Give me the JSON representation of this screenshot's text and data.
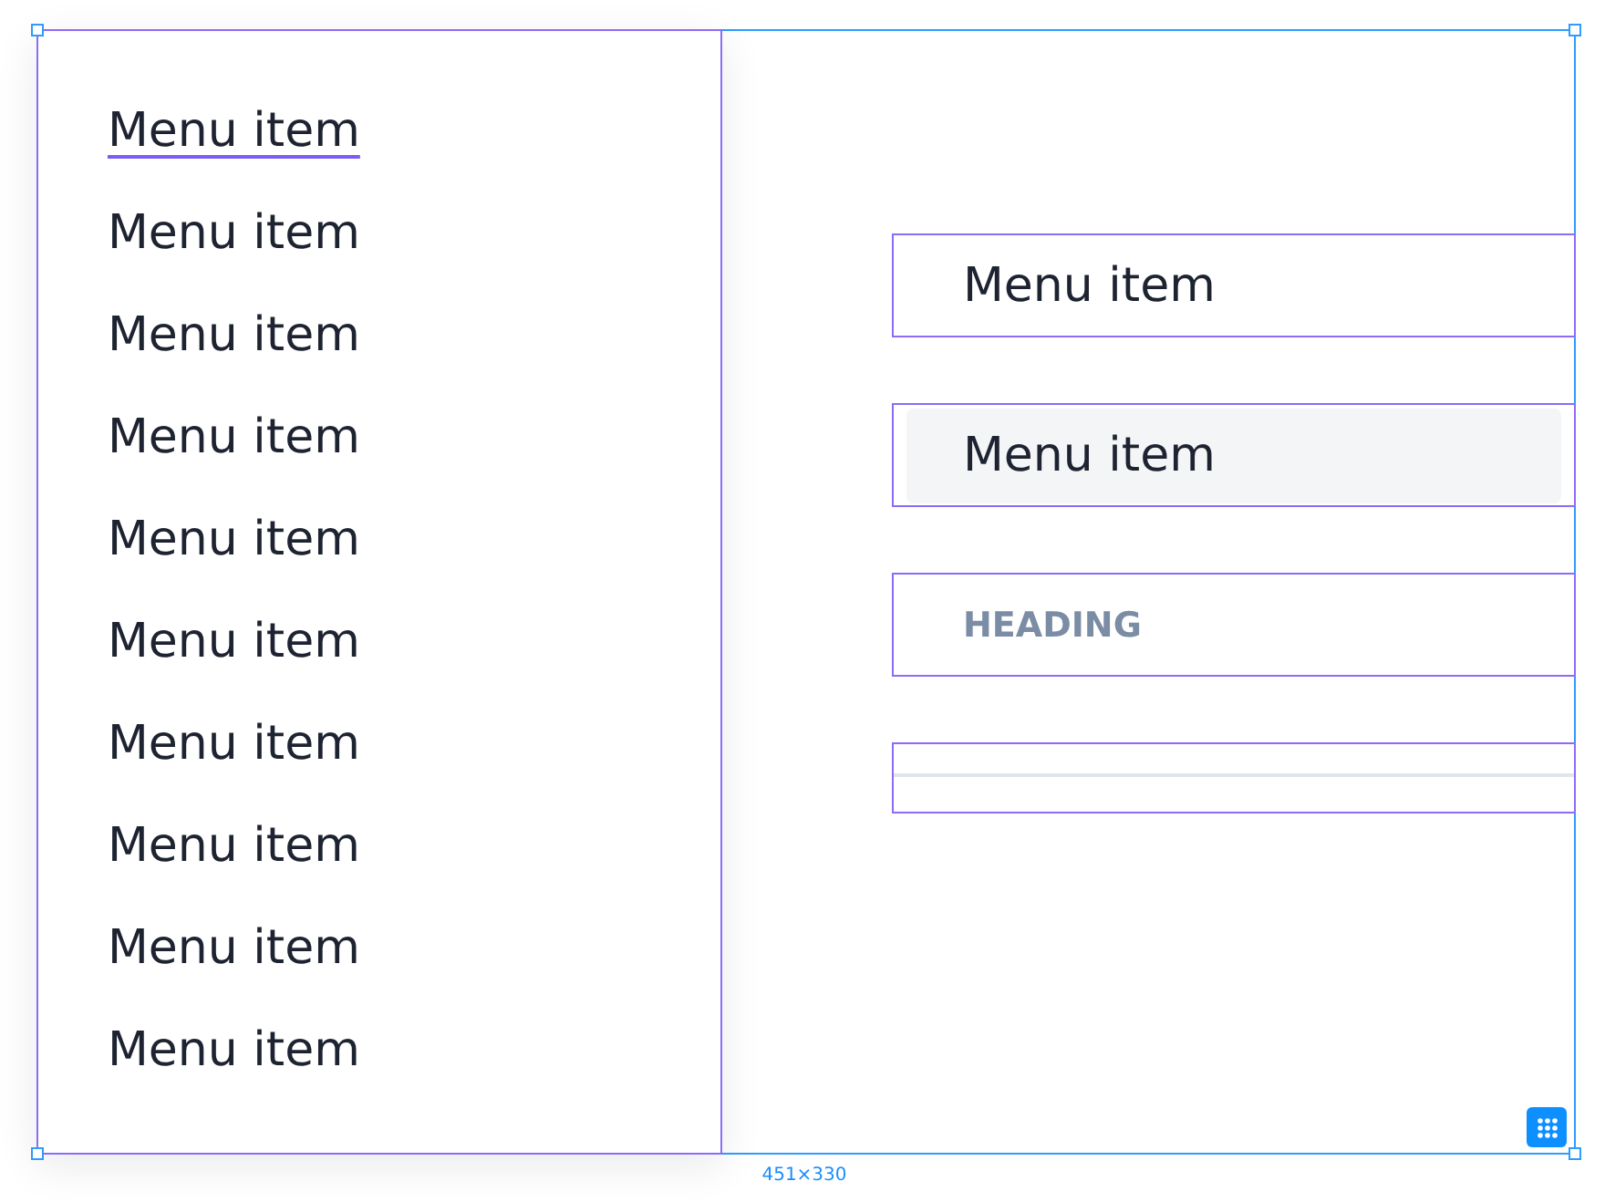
{
  "menu": {
    "items": [
      {
        "label": "Menu item",
        "selected": true
      },
      {
        "label": "Menu item",
        "selected": false
      },
      {
        "label": "Menu item",
        "selected": false
      },
      {
        "label": "Menu item",
        "selected": false
      },
      {
        "label": "Menu item",
        "selected": false
      },
      {
        "label": "Menu item",
        "selected": false
      },
      {
        "label": "Menu item",
        "selected": false
      },
      {
        "label": "Menu item",
        "selected": false
      },
      {
        "label": "Menu item",
        "selected": false
      },
      {
        "label": "Menu item",
        "selected": false
      }
    ]
  },
  "variants": [
    {
      "kind": "item",
      "label": "Menu item",
      "hovered": false
    },
    {
      "kind": "item",
      "label": "Menu item",
      "hovered": true
    },
    {
      "kind": "heading",
      "label": "HEADING"
    },
    {
      "kind": "divider"
    }
  ],
  "frame": {
    "size_label": "451×330"
  }
}
